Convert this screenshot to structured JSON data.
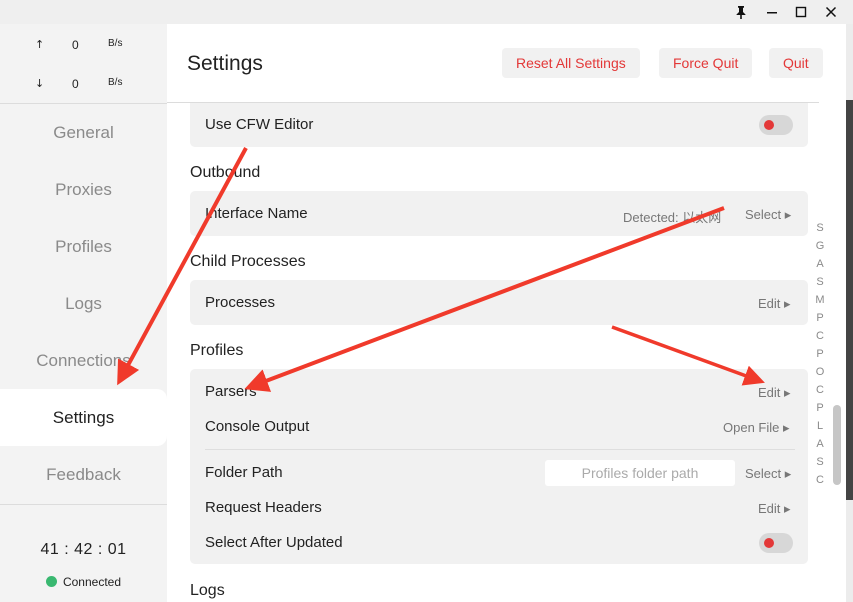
{
  "titlebar": {
    "pin_icon": "pin-icon",
    "minimize_icon": "minimize-icon",
    "maximize_icon": "maximize-icon",
    "close_icon": "close-icon"
  },
  "traffic": {
    "up": {
      "arrow": "↑",
      "value": "0",
      "unit": "B/s"
    },
    "down": {
      "arrow": "↓",
      "value": "0",
      "unit": "B/s"
    }
  },
  "sidebar": {
    "items": [
      {
        "label": "General"
      },
      {
        "label": "Proxies"
      },
      {
        "label": "Profiles"
      },
      {
        "label": "Logs"
      },
      {
        "label": "Connections"
      },
      {
        "label": "Settings",
        "active": true
      },
      {
        "label": "Feedback"
      }
    ],
    "clock": "41 : 42 : 01",
    "status": "Connected",
    "status_color": "#39b870"
  },
  "header": {
    "title": "Settings",
    "reset_label": "Reset All Settings",
    "force_quit_label": "Force Quit",
    "quit_label": "Quit"
  },
  "settings": {
    "use_cfw_editor": {
      "label": "Use CFW Editor",
      "enabled": false
    },
    "outbound": {
      "title": "Outbound",
      "interface_name": {
        "label": "Interface Name",
        "detected": "Detected: 以太网",
        "action": "Select ▸"
      }
    },
    "child_processes": {
      "title": "Child Processes",
      "processes": {
        "label": "Processes",
        "action": "Edit ▸"
      }
    },
    "profiles": {
      "title": "Profiles",
      "parsers": {
        "label": "Parsers",
        "action": "Edit ▸"
      },
      "console_output": {
        "label": "Console Output",
        "action": "Open File ▸"
      },
      "folder_path": {
        "label": "Folder Path",
        "placeholder": "Profiles folder path",
        "action": "Select ▸"
      },
      "request_headers": {
        "label": "Request Headers",
        "action": "Edit ▸"
      },
      "select_after_updated": {
        "label": "Select After Updated",
        "enabled": false
      }
    },
    "logs": {
      "title": "Logs"
    }
  },
  "alpha_index": [
    "S",
    "G",
    "A",
    "S",
    "M",
    "P",
    "C",
    "P",
    "O",
    "C",
    "P",
    "L",
    "A",
    "S",
    "C"
  ],
  "colors": {
    "accent_red": "#e33838",
    "annotation_arrow": "#f03a2b"
  }
}
